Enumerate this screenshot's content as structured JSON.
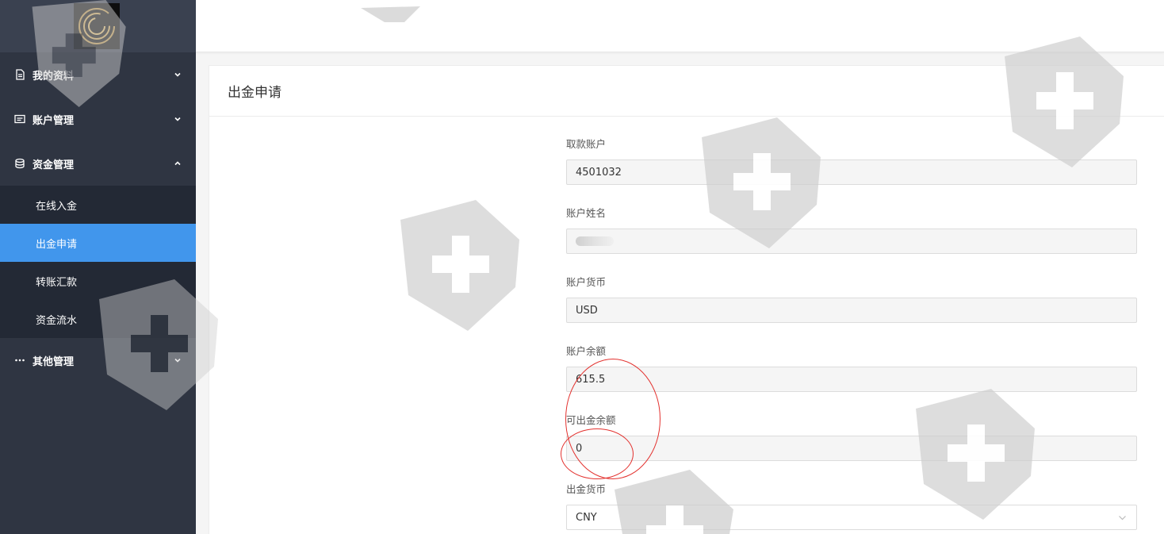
{
  "sidebar": {
    "menu": [
      {
        "label": "我的资料",
        "icon": "document-icon",
        "expanded": false
      },
      {
        "label": "账户管理",
        "icon": "card-icon",
        "expanded": false
      },
      {
        "label": "资金管理",
        "icon": "database-icon",
        "expanded": true
      },
      {
        "label": "其他管理",
        "icon": "more-icon",
        "expanded": false
      }
    ],
    "submenu": [
      {
        "label": "在线入金",
        "active": false
      },
      {
        "label": "出金申请",
        "active": true
      },
      {
        "label": "转账汇款",
        "active": false
      },
      {
        "label": "资金流水",
        "active": false
      }
    ]
  },
  "page": {
    "title": "出金申请"
  },
  "form": {
    "account_label": "取款账户",
    "account_value": "4501032",
    "name_label": "账户姓名",
    "currency_label": "账户货币",
    "currency_value": "USD",
    "balance_label": "账户余额",
    "balance_value": "615.5",
    "withdrawable_label": "可出金余额",
    "withdrawable_value": "0",
    "withdraw_currency_label": "出金货币",
    "withdraw_currency_value": "CNY"
  },
  "colors": {
    "sidebar_bg": "#2f3542",
    "submenu_bg": "#232935",
    "active_bg": "#4196ec",
    "annotation": "#e3322f"
  }
}
